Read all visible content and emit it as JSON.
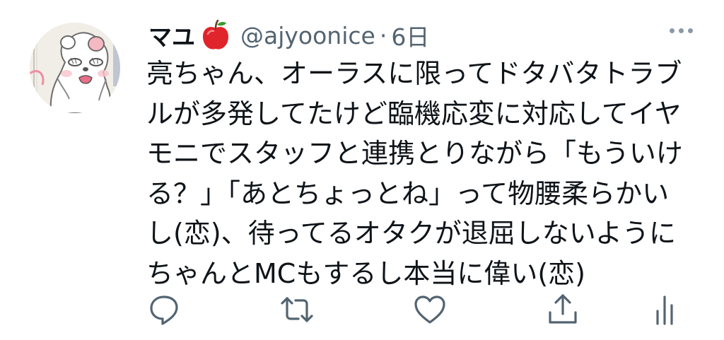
{
  "tweet": {
    "author": {
      "display_name": "マユ",
      "emoji_name": "red-apple",
      "handle": "@ajyoonice",
      "separator": "·",
      "time_ago": "6日"
    },
    "text_lines": [
      "亮ちゃん、オーラスに限ってドタバタトラブ",
      "ルが多発してたけど臨機応変に対応してイヤ",
      "モニでスタッフと連携とりながら「もういけ",
      "る？」「あとちょっとね」って物腰柔らかい",
      "し(恋)、待ってるオタクが退屈しないように",
      "ちゃんとMCもするし本当に偉い(恋)"
    ]
  },
  "actions": [
    {
      "icon": "reply-icon"
    },
    {
      "icon": "retweet-icon"
    },
    {
      "icon": "like-icon"
    },
    {
      "icon": "share-icon"
    },
    {
      "icon": "analytics-icon"
    }
  ],
  "colors": {
    "text": "#0f1419",
    "secondary": "#536471",
    "icon": "#536471",
    "apple": "#e0242b",
    "background": "#ffffff"
  }
}
